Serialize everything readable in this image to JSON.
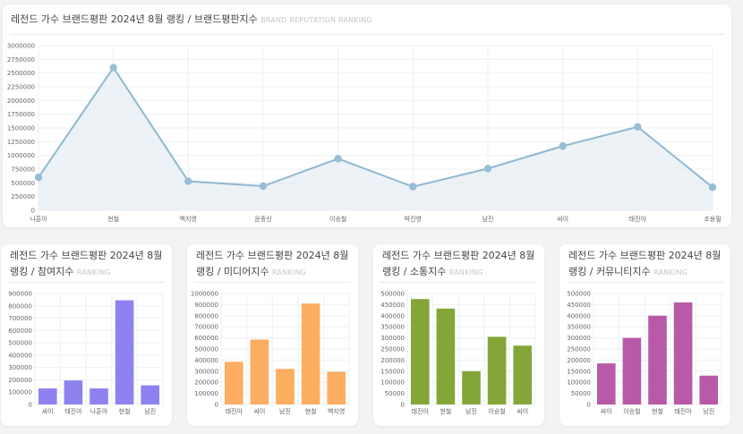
{
  "charts": {
    "top": {
      "title": "레전드 가수 브랜드평판 2024년 8월 랭킹 / 브랜드평판지수",
      "subtitle": "BRAND REPUTATION RANKING",
      "colors": {
        "line": "#8fb8cf",
        "fill": "#e6eef3",
        "point": "#98bed3"
      }
    },
    "c1": {
      "title": "레전드 가수 브랜드평판 2024년 8월 랭킹 / 참여지수",
      "subtitle": "RANKING",
      "color": "#8d82f0"
    },
    "c2": {
      "title": "레전드 가수 브랜드평판 2024년 8월 랭킹 / 미디어지수",
      "subtitle": "RANKING",
      "color": "#fcad60"
    },
    "c3": {
      "title": "레전드 가수 브랜드평판 2024년 8월 랭킹 / 소통지수",
      "subtitle": "RANKING",
      "color": "#84a638"
    },
    "c4": {
      "title": "레전드 가수 브랜드평판 2024년 8월 랭킹 / 커뮤니티지수",
      "subtitle": "RANKING",
      "color": "#b85aa8"
    }
  },
  "chart_data": [
    {
      "type": "area",
      "title": "레전드 가수 브랜드평판 2024년 8월 랭킹 / 브랜드평판지수",
      "categories": [
        "나훈아",
        "현철",
        "백지영",
        "윤종신",
        "이승철",
        "박진영",
        "남진",
        "싸이",
        "태진아",
        "조용필"
      ],
      "values": [
        600000,
        2600000,
        530000,
        440000,
        940000,
        430000,
        760000,
        1170000,
        1520000,
        420000
      ],
      "yticks": [
        "0",
        "250000",
        "500000",
        "750000",
        "1000000",
        "1250000",
        "1500000",
        "1750000",
        "2000000",
        "2250000",
        "2500000",
        "2750000",
        "3000000"
      ],
      "ylim": [
        0,
        3000000
      ],
      "grid": true
    },
    {
      "type": "bar",
      "title": "레전드 가수 브랜드평판 2024년 8월 랭킹 / 참여지수",
      "categories": [
        "싸이",
        "태진아",
        "나훈아",
        "현철",
        "남진"
      ],
      "values": [
        130000,
        195000,
        130000,
        845000,
        155000
      ],
      "yticks": [
        "0",
        "100000",
        "200000",
        "300000",
        "400000",
        "500000",
        "600000",
        "700000",
        "800000",
        "900000"
      ],
      "ylim": [
        0,
        900000
      ],
      "grid": true
    },
    {
      "type": "bar",
      "title": "레전드 가수 브랜드평판 2024년 8월 랭킹 / 미디어지수",
      "categories": [
        "태진아",
        "싸이",
        "남진",
        "현철",
        "백지영"
      ],
      "values": [
        385000,
        585000,
        320000,
        910000,
        295000
      ],
      "yticks": [
        "0",
        "100000",
        "200000",
        "300000",
        "400000",
        "500000",
        "600000",
        "700000",
        "800000",
        "900000",
        "1000000"
      ],
      "ylim": [
        0,
        1000000
      ],
      "grid": true
    },
    {
      "type": "bar",
      "title": "레전드 가수 브랜드평판 2024년 8월 랭킹 / 소통지수",
      "categories": [
        "태진아",
        "현철",
        "남진",
        "이승철",
        "싸이"
      ],
      "values": [
        475000,
        432000,
        150000,
        305000,
        265000
      ],
      "yticks": [
        "0",
        "50000",
        "100000",
        "150000",
        "200000",
        "250000",
        "300000",
        "350000",
        "400000",
        "450000",
        "500000"
      ],
      "ylim": [
        0,
        500000
      ],
      "grid": true
    },
    {
      "type": "bar",
      "title": "레전드 가수 브랜드평판 2024년 8월 랭킹 / 커뮤니티지수",
      "categories": [
        "싸이",
        "이승철",
        "현철",
        "태진아",
        "남진"
      ],
      "values": [
        185000,
        300000,
        400000,
        460000,
        130000
      ],
      "yticks": [
        "0",
        "50000",
        "100000",
        "150000",
        "200000",
        "250000",
        "300000",
        "350000",
        "400000",
        "450000",
        "500000"
      ],
      "ylim": [
        0,
        500000
      ],
      "grid": true
    }
  ]
}
